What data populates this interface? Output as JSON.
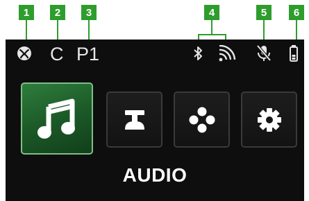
{
  "callouts": [
    "1",
    "2",
    "3",
    "4",
    "5",
    "6"
  ],
  "status_bar": {
    "profile_letter": "C",
    "preset": "P1",
    "icons": [
      "xbox-logo-icon",
      "bluetooth-icon",
      "wireless-signal-icon",
      "mic-muted-icon",
      "battery-icon"
    ]
  },
  "menu": {
    "tiles": [
      {
        "icon": "music-note-icon",
        "active": true
      },
      {
        "icon": "equalizer-slider-icon",
        "active": false
      },
      {
        "icon": "dpad-buttons-icon",
        "active": false
      },
      {
        "icon": "settings-gear-icon",
        "active": false
      }
    ],
    "selected_label": "AUDIO"
  },
  "colors": {
    "callout_green": "#2f9d2d",
    "screen_bg": "#0e0e0e",
    "active_tile_green": "#2e7d3c",
    "text": "#e6e6e6"
  }
}
